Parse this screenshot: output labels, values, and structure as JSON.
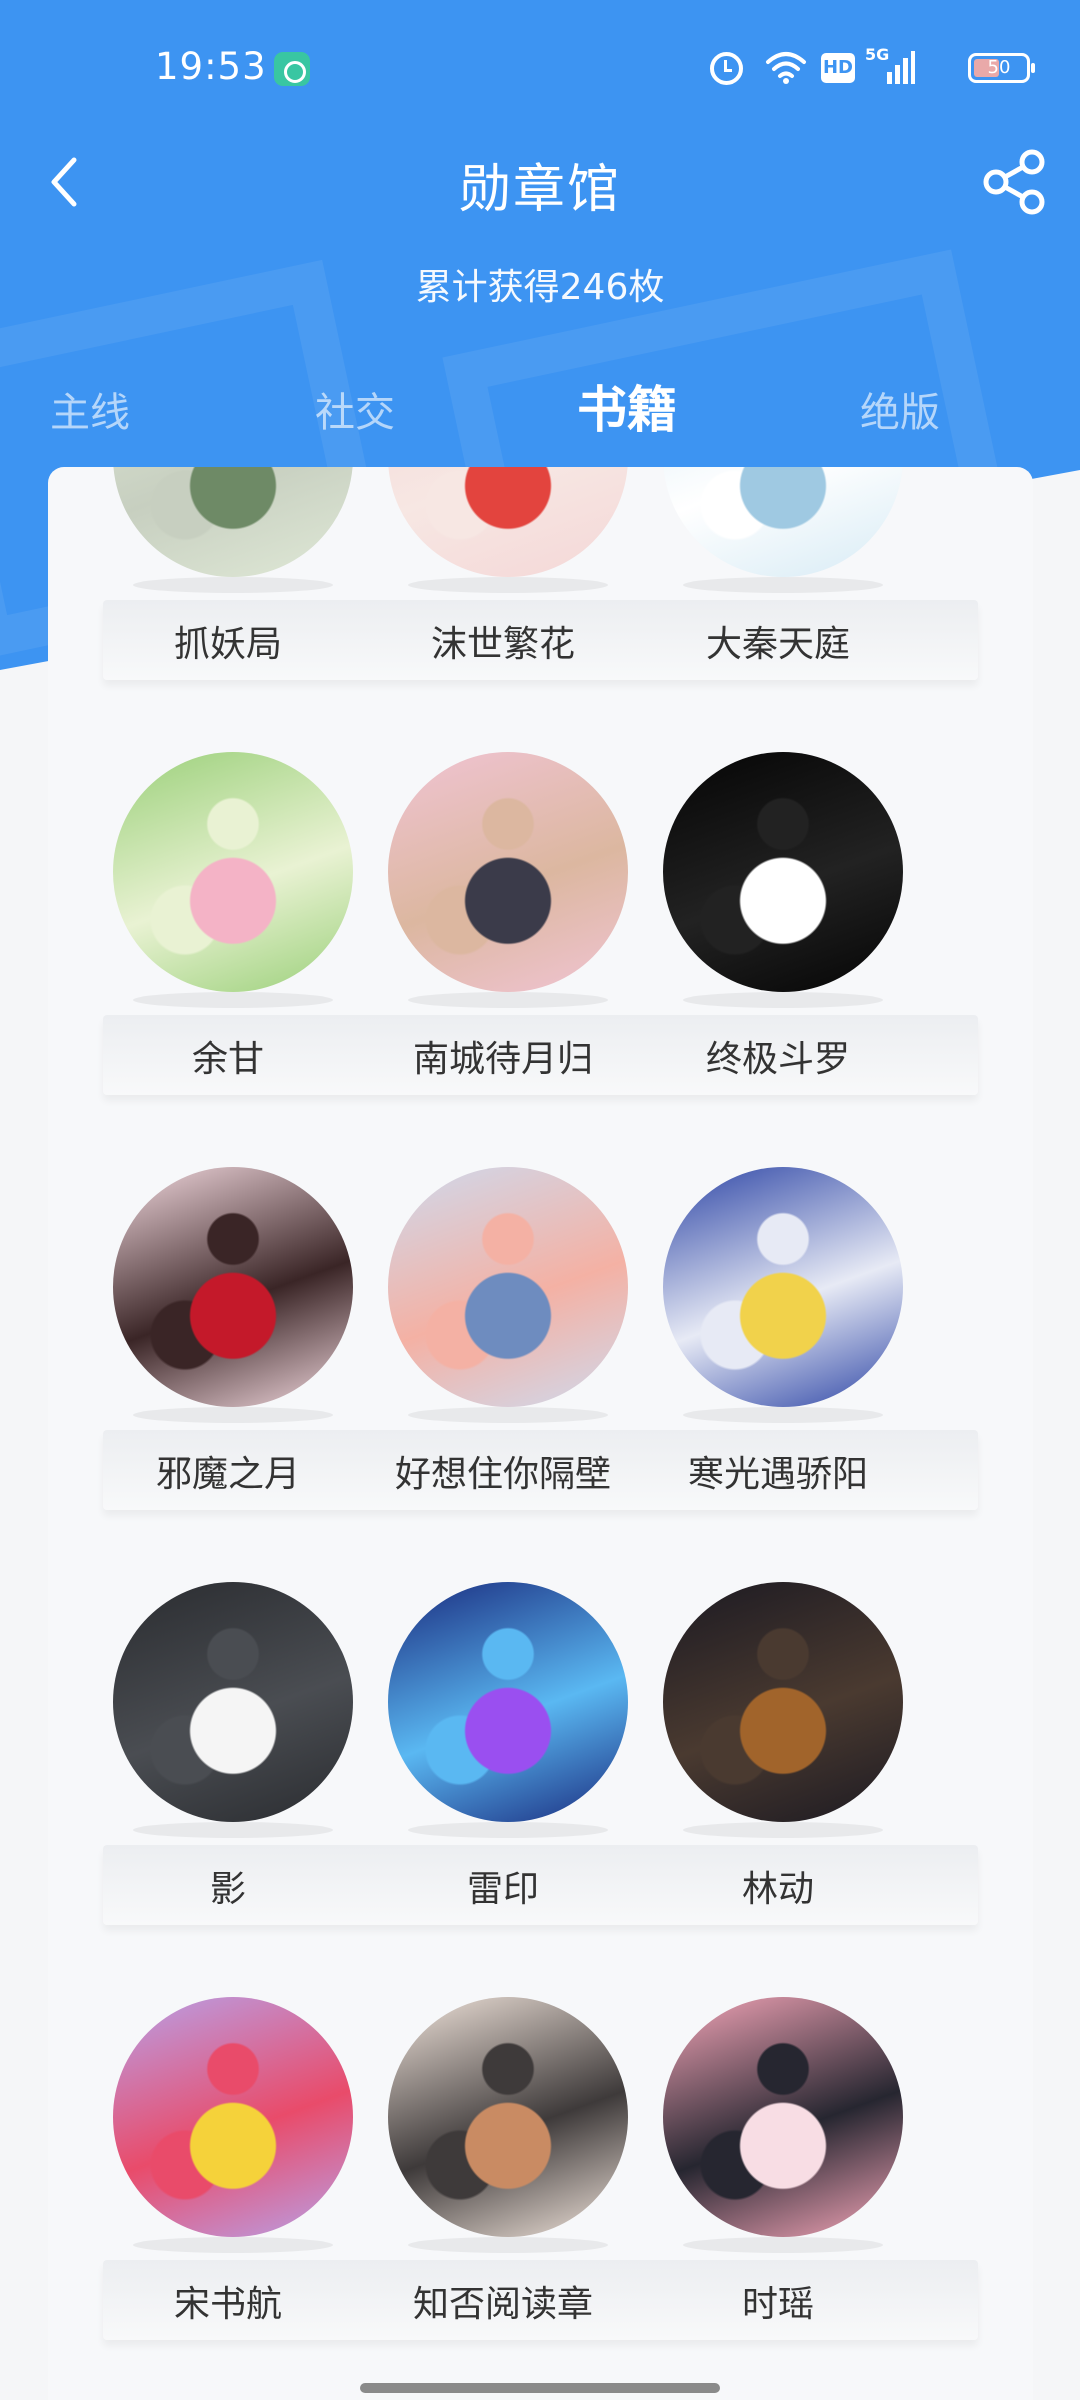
{
  "status_bar": {
    "time": "19:53",
    "network": "5G",
    "hd": "HD",
    "battery": "50",
    "battery_level_percent": 50,
    "icons": [
      "app-notification-icon",
      "alarm-icon",
      "wifi-icon",
      "hd-icon",
      "signal-icon",
      "battery-icon"
    ]
  },
  "header": {
    "title": "勋章馆",
    "subtitle": "累计获得246枚",
    "back_icon": "chevron-left-icon",
    "share_icon": "share-icon"
  },
  "tabs": [
    {
      "label": "主线",
      "active": false
    },
    {
      "label": "社交",
      "active": false
    },
    {
      "label": "书籍",
      "active": true
    },
    {
      "label": "绝版",
      "active": false
    }
  ],
  "badges": [
    {
      "name": "抓妖局",
      "colors": [
        "#dfe8d6",
        "#6e8a66",
        "#c7cfc0"
      ]
    },
    {
      "name": "沫世繁花",
      "colors": [
        "#f4d7d7",
        "#e3443e",
        "#f7e7e3"
      ]
    },
    {
      "name": "大秦天庭",
      "colors": [
        "#d7ebf5",
        "#9fc9e2",
        "#ffffff"
      ]
    },
    {
      "name": "余甘",
      "colors": [
        "#9bd07a",
        "#f4b3c6",
        "#e9f2d3"
      ]
    },
    {
      "name": "南城待月归",
      "colors": [
        "#f0c4d3",
        "#3b3b4a",
        "#dcb7a0"
      ]
    },
    {
      "name": "终极斗罗",
      "colors": [
        "#050505",
        "#ffffff",
        "#222222"
      ]
    },
    {
      "name": "邪魔之月",
      "colors": [
        "#f3d9df",
        "#c4192a",
        "#3a2526"
      ]
    },
    {
      "name": "好想住你隔壁",
      "colors": [
        "#cfd9ec",
        "#6e8cbf",
        "#f4b1a4"
      ]
    },
    {
      "name": "寒光遇骄阳",
      "colors": [
        "#2e46a6",
        "#f1d24b",
        "#e7eaf5"
      ]
    },
    {
      "name": "影",
      "colors": [
        "#2a2c30",
        "#f5f5f5",
        "#4a4d52"
      ]
    },
    {
      "name": "雷印",
      "colors": [
        "#1a2b7e",
        "#9a4ff0",
        "#5ab8f2"
      ]
    },
    {
      "name": "林动",
      "colors": [
        "#1c1a22",
        "#a1642b",
        "#4a3a30"
      ]
    },
    {
      "name": "宋书航",
      "colors": [
        "#b8a1e8",
        "#f5d23a",
        "#e94b6a"
      ]
    },
    {
      "name": "知否阅读章",
      "colors": [
        "#f2e5dc",
        "#c98b63",
        "#3e3a3a"
      ]
    },
    {
      "name": "时瑶",
      "colors": [
        "#f6a6b9",
        "#f8dde4",
        "#262630"
      ]
    }
  ]
}
